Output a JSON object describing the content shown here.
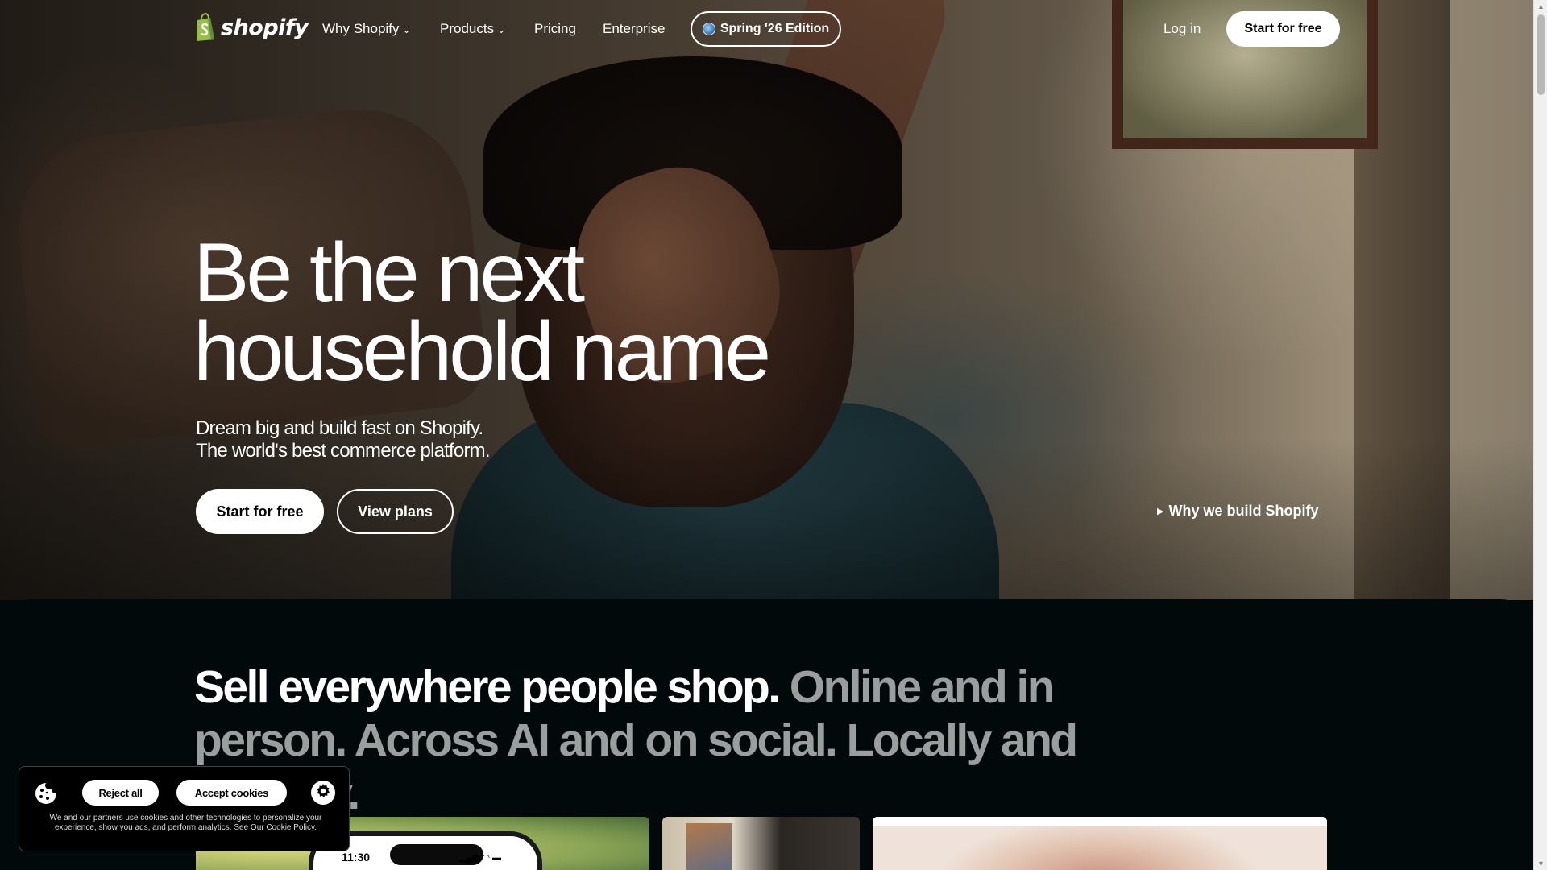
{
  "nav": {
    "logo_text": "shopify",
    "links": [
      {
        "label": "Why Shopify",
        "has_dropdown": true
      },
      {
        "label": "Products",
        "has_dropdown": true
      },
      {
        "label": "Pricing",
        "has_dropdown": false
      },
      {
        "label": "Enterprise",
        "has_dropdown": false
      }
    ],
    "edition_label": "Spring '26 Edition",
    "login_label": "Log in",
    "cta_label": "Start for free"
  },
  "hero": {
    "headline_line1": "Be the next",
    "headline_line2": "household name",
    "sub_line1": "Dream big and build fast on Shopify.",
    "sub_line2": "The world's best commerce platform.",
    "cta_primary": "Start for free",
    "cta_secondary": "View plans",
    "video_link": "Why we build Shopify"
  },
  "sell": {
    "lead": "Sell everywhere people shop.",
    "rest": " Online and in person. Across AI and on social. Locally and globally."
  },
  "cards": {
    "phone_time": "11:30",
    "phone_status": "▂▄▆ ◠ ▬"
  },
  "cookie": {
    "reject_label": "Reject all",
    "accept_label": "Accept cookies",
    "text": "We and our partners use cookies and other technologies to personalize your experience, show you ads, and perform analytics. See Our ",
    "link_label": "Cookie Policy",
    "text_end": "."
  },
  "colors": {
    "brand_green": "#95bf47",
    "dark_bg": "#02090a",
    "muted_text": "#9a9e9f"
  },
  "icons": [
    "shopify-bag-icon",
    "chevron-down-icon",
    "globe-icon",
    "play-icon",
    "cookie-icon",
    "gear-icon",
    "scroll-up-arrow-icon",
    "scroll-down-arrow-icon"
  ]
}
